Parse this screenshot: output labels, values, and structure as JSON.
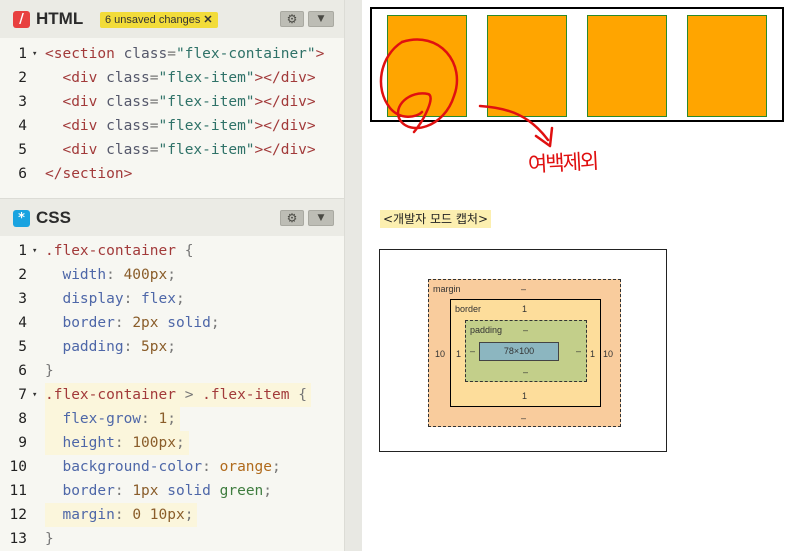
{
  "html_panel": {
    "icon": "/",
    "icon_color": "#e8403f",
    "title": "HTML",
    "unsaved": "6 unsaved changes",
    "unsaved_close": "✕",
    "settings_icon": "gear-icon",
    "collapse_icon": "chevron-down-icon",
    "lines": [
      {
        "n": "1",
        "fold": "▾",
        "html": [
          [
            "tag",
            "<section "
          ],
          [
            "attr",
            "class"
          ],
          [
            "punc",
            "="
          ],
          [
            "str",
            "\"flex-container\""
          ],
          [
            "tag",
            ">"
          ]
        ]
      },
      {
        "n": "2",
        "html": [
          [
            "tag",
            "  <div "
          ],
          [
            "attr",
            "class"
          ],
          [
            "punc",
            "="
          ],
          [
            "str",
            "\"flex-item\""
          ],
          [
            "tag",
            "></div>"
          ]
        ]
      },
      {
        "n": "3",
        "html": [
          [
            "tag",
            "  <div "
          ],
          [
            "attr",
            "class"
          ],
          [
            "punc",
            "="
          ],
          [
            "str",
            "\"flex-item\""
          ],
          [
            "tag",
            "></div>"
          ]
        ]
      },
      {
        "n": "4",
        "html": [
          [
            "tag",
            "  <div "
          ],
          [
            "attr",
            "class"
          ],
          [
            "punc",
            "="
          ],
          [
            "str",
            "\"flex-item\""
          ],
          [
            "tag",
            "></div>"
          ]
        ]
      },
      {
        "n": "5",
        "html": [
          [
            "tag",
            "  <div "
          ],
          [
            "attr",
            "class"
          ],
          [
            "punc",
            "="
          ],
          [
            "str",
            "\"flex-item\""
          ],
          [
            "tag",
            "></div>"
          ]
        ]
      },
      {
        "n": "6",
        "html": [
          [
            "tag",
            "</section>"
          ]
        ]
      }
    ]
  },
  "css_panel": {
    "icon": "*",
    "icon_color": "#1aa3e0",
    "title": "CSS",
    "settings_icon": "gear-icon",
    "collapse_icon": "chevron-down-icon",
    "lines": [
      {
        "n": "1",
        "fold": "▾",
        "html": [
          [
            "sel",
            ".flex-container "
          ],
          [
            "punc",
            "{"
          ]
        ]
      },
      {
        "n": "2",
        "html": [
          [
            "prop",
            "  width"
          ],
          [
            "punc",
            ": "
          ],
          [
            "num",
            "400px"
          ],
          [
            "punc",
            ";"
          ]
        ]
      },
      {
        "n": "3",
        "html": [
          [
            "prop",
            "  display"
          ],
          [
            "punc",
            ": "
          ],
          [
            "prop",
            "flex"
          ],
          [
            "punc",
            ";"
          ]
        ]
      },
      {
        "n": "4",
        "html": [
          [
            "prop",
            "  border"
          ],
          [
            "punc",
            ": "
          ],
          [
            "num",
            "2px"
          ],
          [
            "prop",
            " solid"
          ],
          [
            "punc",
            ";"
          ]
        ]
      },
      {
        "n": "5",
        "html": [
          [
            "prop",
            "  padding"
          ],
          [
            "punc",
            ": "
          ],
          [
            "num",
            "5px"
          ],
          [
            "punc",
            ";"
          ]
        ]
      },
      {
        "n": "6",
        "html": [
          [
            "punc",
            "}"
          ]
        ]
      },
      {
        "n": "7",
        "fold": "▾",
        "hl": true,
        "html": [
          [
            "sel",
            ".flex-container "
          ],
          [
            "punc",
            "> "
          ],
          [
            "sel",
            ".flex-item "
          ],
          [
            "punc",
            "{"
          ]
        ]
      },
      {
        "n": "8",
        "hl": true,
        "html": [
          [
            "prop",
            "  flex-grow"
          ],
          [
            "punc",
            ": "
          ],
          [
            "num",
            "1"
          ],
          [
            "punc",
            ";"
          ]
        ]
      },
      {
        "n": "9",
        "hl": true,
        "html": [
          [
            "prop",
            "  height"
          ],
          [
            "punc",
            ": "
          ],
          [
            "num",
            "100px"
          ],
          [
            "punc",
            ";"
          ]
        ]
      },
      {
        "n": "10",
        "html": [
          [
            "prop",
            "  background-color"
          ],
          [
            "punc",
            ": "
          ],
          [
            "kw",
            "orange"
          ],
          [
            "punc",
            ";"
          ]
        ]
      },
      {
        "n": "11",
        "html": [
          [
            "prop",
            "  border"
          ],
          [
            "punc",
            ": "
          ],
          [
            "num",
            "1px"
          ],
          [
            "prop",
            " solid "
          ],
          [
            "grn",
            "green"
          ],
          [
            "punc",
            ";"
          ]
        ]
      },
      {
        "n": "12",
        "hl": true,
        "html": [
          [
            "prop",
            "  margin"
          ],
          [
            "punc",
            ": "
          ],
          [
            "num",
            "0 10px"
          ],
          [
            "punc",
            ";"
          ]
        ]
      },
      {
        "n": "13",
        "html": [
          [
            "punc",
            "}"
          ]
        ]
      }
    ]
  },
  "output": {
    "annotation": "여백제외",
    "capture_title": "<개발자 모드 캡처>",
    "box_model": {
      "margin_label": "margin",
      "margin_top": "–",
      "margin_bottom": "–",
      "margin_left": "10",
      "margin_right": "10",
      "border_label": "border",
      "border_top": "1",
      "border_bottom": "1",
      "border_left": "1",
      "border_right": "1",
      "padding_label": "padding",
      "padding_top": "–",
      "padding_bottom": "–",
      "padding_left": "–",
      "padding_right": "–",
      "content": "78×100"
    }
  }
}
